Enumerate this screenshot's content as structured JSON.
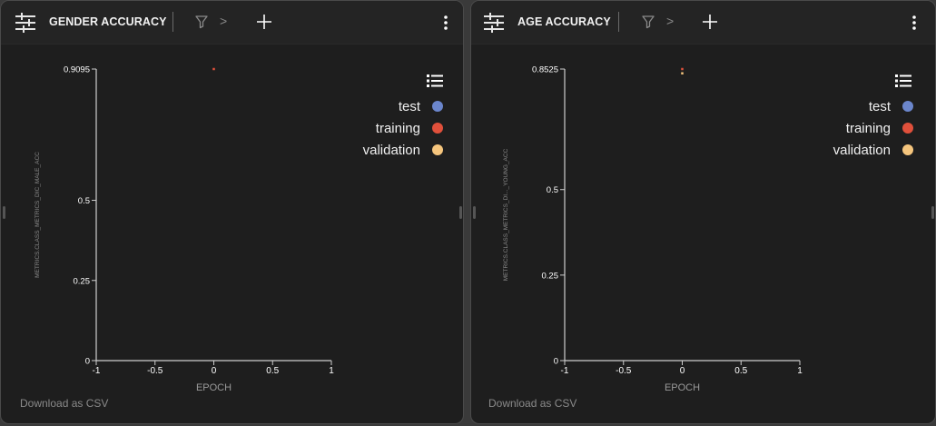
{
  "panels": [
    {
      "title": "GENDER ACCURACY",
      "filter_chevron": ">",
      "legend_items": [
        {
          "label": "test",
          "color": "#6b86cc"
        },
        {
          "label": "training",
          "color": "#e0503b"
        },
        {
          "label": "validation",
          "color": "#f5c57d"
        }
      ],
      "download_label": "Download as CSV"
    },
    {
      "title": "AGE ACCURACY",
      "filter_chevron": ">",
      "legend_items": [
        {
          "label": "test",
          "color": "#6b86cc"
        },
        {
          "label": "training",
          "color": "#e0503b"
        },
        {
          "label": "validation",
          "color": "#f5c57d"
        }
      ],
      "download_label": "Download as CSV"
    }
  ],
  "chart_data": [
    {
      "type": "scatter",
      "xlabel": "EPOCH",
      "ylabel": "METRICS.CLASS_METRICS_DIC_MALE_ACC",
      "xlim": [
        -1,
        1
      ],
      "ylim": [
        0,
        0.9095
      ],
      "xticks": [
        "-1",
        "-0.5",
        "0",
        "0.5",
        "1"
      ],
      "xtick_values": [
        -1,
        -0.5,
        0,
        0.5,
        1
      ],
      "yticks": [
        "0",
        "0.25",
        "0.5",
        "0.9095"
      ],
      "ytick_values": [
        0,
        0.25,
        0.5,
        0.9095
      ],
      "grid": false,
      "legend_position": "top-right",
      "series": [
        {
          "name": "test",
          "color": "#6b86cc",
          "x": [],
          "y": []
        },
        {
          "name": "training",
          "color": "#e0503b",
          "x": [
            0
          ],
          "y": [
            0.9095
          ]
        },
        {
          "name": "validation",
          "color": "#f5c57d",
          "x": [],
          "y": []
        }
      ]
    },
    {
      "type": "scatter",
      "xlabel": "EPOCH",
      "ylabel": "METRICS.CLASS_METRICS_DI..._YOUNG_ACC",
      "xlim": [
        -1,
        1
      ],
      "ylim": [
        0,
        0.8525
      ],
      "xticks": [
        "-1",
        "-0.5",
        "0",
        "0.5",
        "1"
      ],
      "xtick_values": [
        -1,
        -0.5,
        0,
        0.5,
        1
      ],
      "yticks": [
        "0",
        "0.25",
        "0.5",
        "0.8525"
      ],
      "ytick_values": [
        0,
        0.25,
        0.5,
        0.8525
      ],
      "grid": false,
      "legend_position": "top-right",
      "series": [
        {
          "name": "test",
          "color": "#6b86cc",
          "x": [],
          "y": []
        },
        {
          "name": "training",
          "color": "#e0503b",
          "x": [
            0
          ],
          "y": [
            0.8525
          ]
        },
        {
          "name": "validation",
          "color": "#f5c57d",
          "x": [
            0
          ],
          "y": [
            0.84
          ]
        }
      ]
    }
  ]
}
